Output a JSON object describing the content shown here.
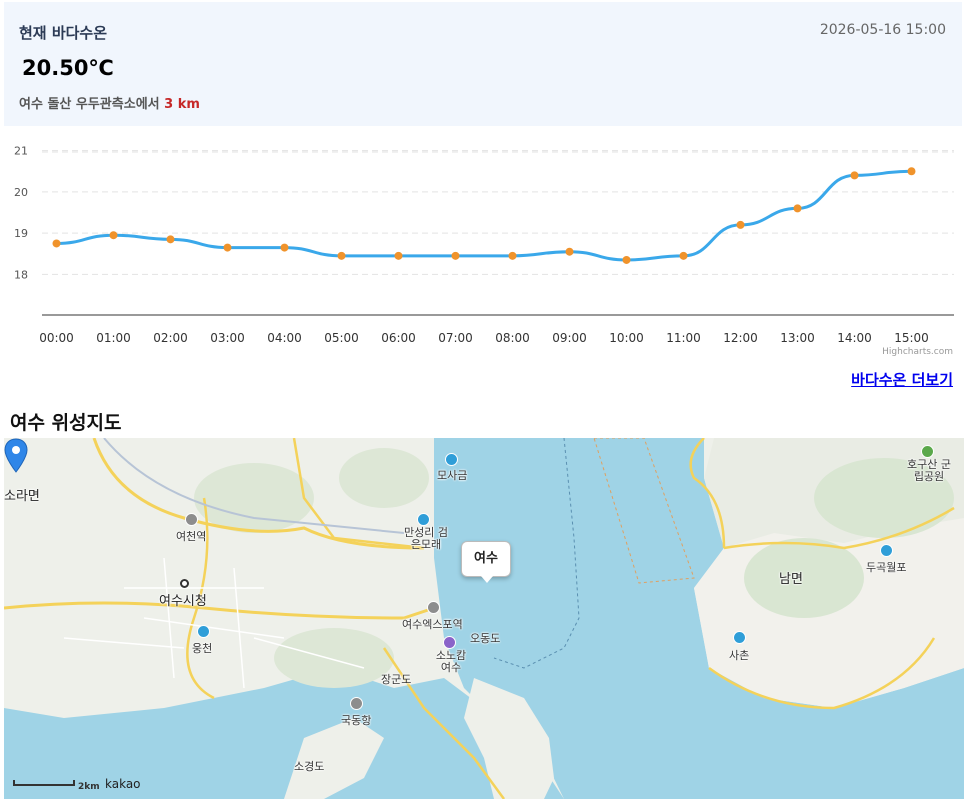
{
  "header": {
    "title": "현재 바다수온",
    "timestamp": "2026-05-16 15:00",
    "temperature": "20.50℃",
    "location_prefix": "여수 돌산 우두관측소에서",
    "distance": "3 km"
  },
  "chart_data": {
    "type": "line",
    "categories": [
      "00:00",
      "01:00",
      "02:00",
      "03:00",
      "04:00",
      "05:00",
      "06:00",
      "07:00",
      "08:00",
      "09:00",
      "10:00",
      "11:00",
      "12:00",
      "13:00",
      "14:00",
      "15:00"
    ],
    "series": [
      {
        "values": [
          18.75,
          18.95,
          18.85,
          18.65,
          18.65,
          18.45,
          18.45,
          18.45,
          18.45,
          18.55,
          18.35,
          18.45,
          19.2,
          19.6,
          20.4,
          20.5
        ],
        "color": "#3aa8ea",
        "marker_color": "#f0932b"
      }
    ],
    "ylim": [
      17.5,
      21.5
    ],
    "yticks": [
      "18",
      "19",
      "20",
      "21"
    ],
    "grid": true,
    "credits": "Highcharts.com"
  },
  "more_link": "바다수온 더보기",
  "map": {
    "title": "여수 위성지도",
    "popup_label": "여수",
    "scale_label": "2km",
    "brand": "kakao",
    "places": [
      "소라면",
      "여천역",
      "여수시청",
      "웅천",
      "모사금",
      "만성리 검은모래",
      "여수엑스포역",
      "소노캄 여수",
      "오동도",
      "장군도",
      "국동항",
      "소경도",
      "호구산 군립공원",
      "남면",
      "두곡월포",
      "사촌"
    ]
  }
}
